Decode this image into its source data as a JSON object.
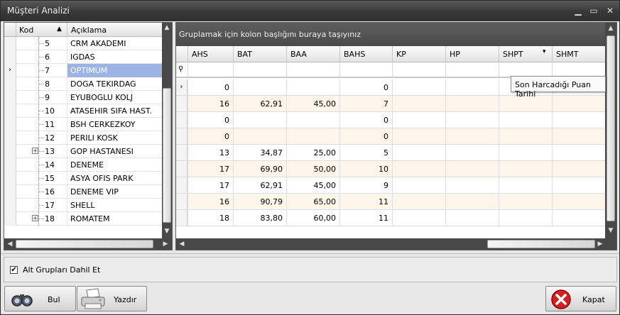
{
  "window": {
    "title": "Müşteri Analizi"
  },
  "tree": {
    "headers": {
      "kod": "Kod",
      "aciklama": "Açıklama"
    },
    "rows": [
      {
        "code": "5",
        "desc": "CRM AKADEMI",
        "expand": false,
        "selected": false
      },
      {
        "code": "6",
        "desc": "IGDAS",
        "expand": false,
        "selected": false
      },
      {
        "code": "7",
        "desc": "OPTIMUM",
        "expand": false,
        "selected": true
      },
      {
        "code": "8",
        "desc": "DOGA TEKIRDAG",
        "expand": false,
        "selected": false
      },
      {
        "code": "9",
        "desc": "EYUBOGLU KOLJ",
        "expand": false,
        "selected": false
      },
      {
        "code": "10",
        "desc": "ATASEHIR SIFA HAST.",
        "expand": false,
        "selected": false
      },
      {
        "code": "11",
        "desc": "BSH CERKEZKOY",
        "expand": false,
        "selected": false
      },
      {
        "code": "12",
        "desc": "PERILI KOSK",
        "expand": false,
        "selected": false
      },
      {
        "code": "13",
        "desc": "GOP HASTANESI",
        "expand": true,
        "selected": false
      },
      {
        "code": "14",
        "desc": "DENEME",
        "expand": false,
        "selected": false
      },
      {
        "code": "15",
        "desc": "ASYA OFIS PARK",
        "expand": false,
        "selected": false
      },
      {
        "code": "16",
        "desc": "DENEME VIP",
        "expand": false,
        "selected": false
      },
      {
        "code": "17",
        "desc": "SHELL",
        "expand": false,
        "selected": false
      },
      {
        "code": "18",
        "desc": "ROMATEM",
        "expand": true,
        "selected": false
      }
    ]
  },
  "grid": {
    "group_hint": "Gruplamak için kolon başlığını buraya taşıyınız",
    "columns": [
      "AHS",
      "BAT",
      "BAA",
      "BAHS",
      "KP",
      "HP",
      "SHPT",
      "SHMT"
    ],
    "rows": [
      [
        "0",
        "",
        "",
        "0",
        "",
        "",
        "",
        ""
      ],
      [
        "16",
        "62,91",
        "45,00",
        "7",
        "",
        "",
        "",
        ""
      ],
      [
        "0",
        "",
        "",
        "0",
        "",
        "",
        "",
        ""
      ],
      [
        "0",
        "",
        "",
        "0",
        "",
        "",
        "",
        ""
      ],
      [
        "13",
        "34,87",
        "25,00",
        "5",
        "",
        "",
        "",
        ""
      ],
      [
        "17",
        "69,90",
        "50,00",
        "10",
        "",
        "",
        "",
        ""
      ],
      [
        "17",
        "62,91",
        "45,00",
        "9",
        "",
        "",
        "",
        ""
      ],
      [
        "16",
        "90,79",
        "65,00",
        "11",
        "",
        "",
        "",
        ""
      ],
      [
        "18",
        "83,80",
        "60,00",
        "11",
        "",
        "",
        "",
        ""
      ]
    ],
    "tooltip": "Son Harcadığı Puan Tarihi"
  },
  "options": {
    "include_subgroups_label": "Alt Grupları Dahil Et",
    "include_subgroups_checked": true
  },
  "buttons": {
    "find": "Bul",
    "print": "Yazdır",
    "close": "Kapat"
  }
}
